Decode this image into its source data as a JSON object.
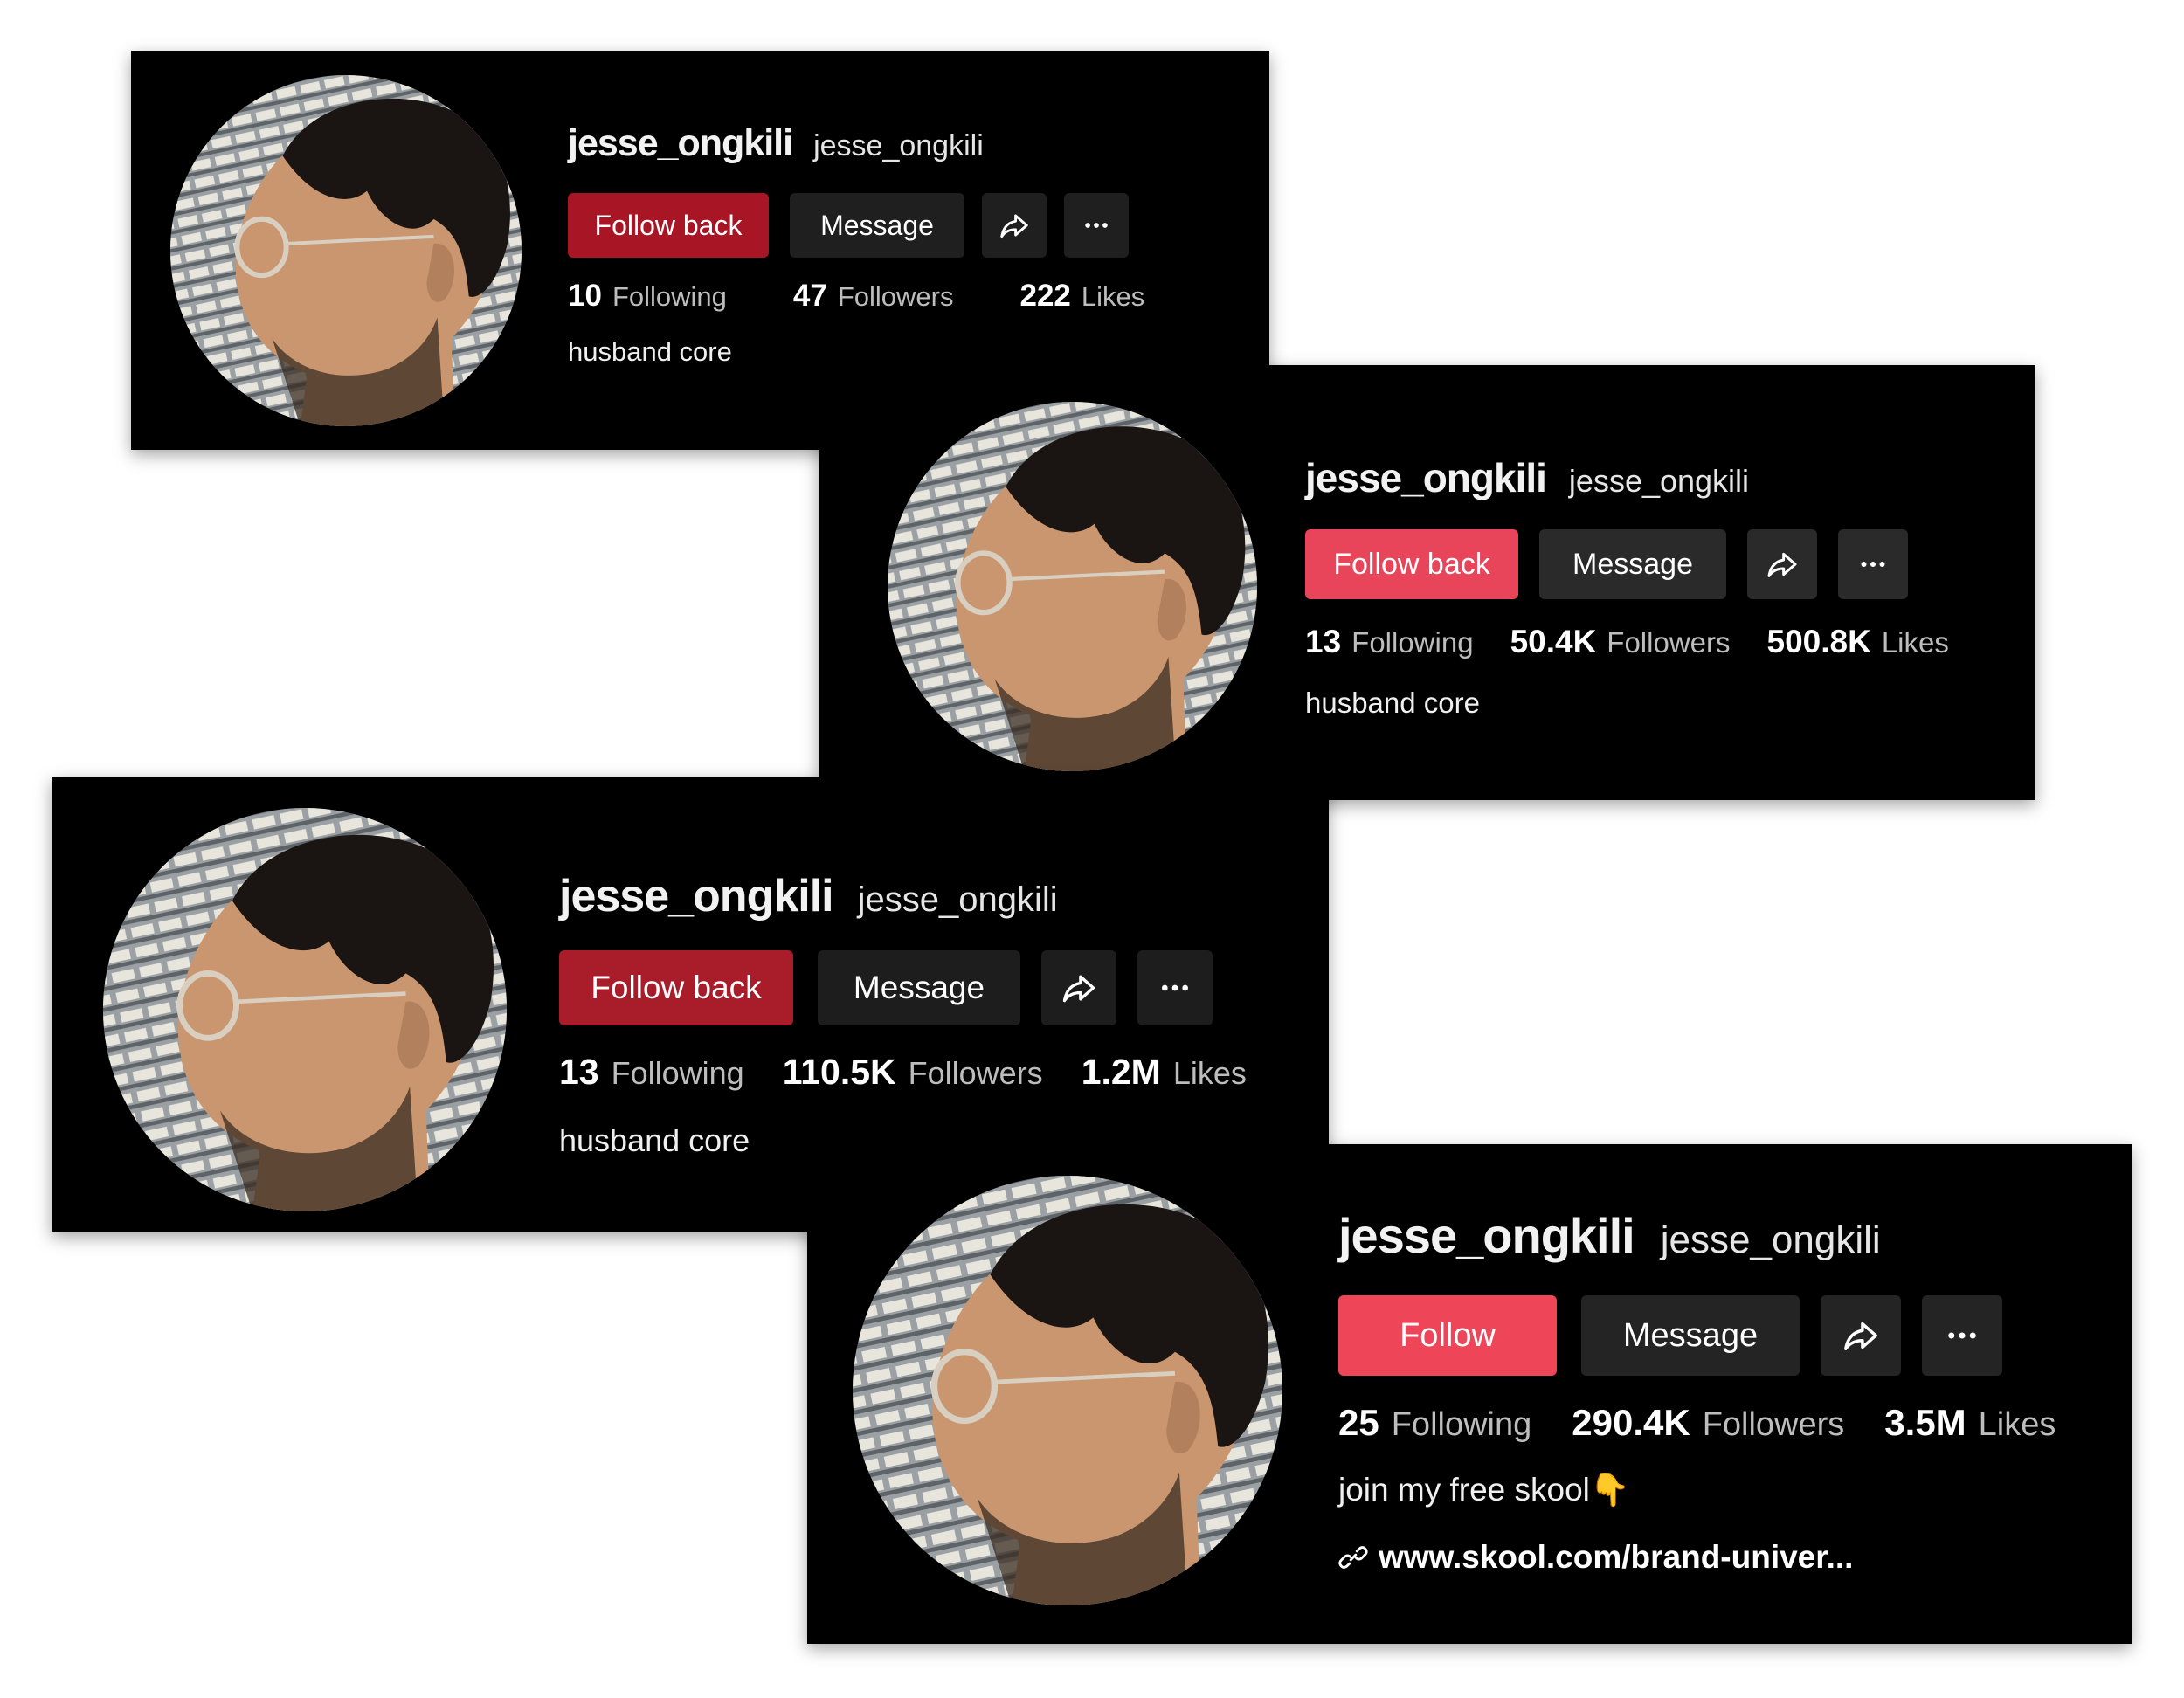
{
  "colors": {
    "card_background": "#000000",
    "page_background": "#ffffff",
    "follow_dark_red": "#a81525",
    "follow_red": "#e8445a",
    "follow_bright_red": "#ee4559",
    "secondary_button": "#1f1f1f",
    "stat_label": "#bdbdbd"
  },
  "icons": {
    "share": "share-arrow-icon",
    "more": "more-dots-icon",
    "link": "link-chain-icon",
    "pointing_down": "pointing-down-hand-emoji"
  },
  "profiles": [
    {
      "display_name": "jesse_ongkili",
      "handle": "jesse_ongkili",
      "follow_label": "Follow back",
      "message_label": "Message",
      "stats": [
        {
          "value": "10",
          "label": "Following"
        },
        {
          "value": "47",
          "label": "Followers"
        },
        {
          "value": "222",
          "label": "Likes"
        }
      ],
      "bio": "husband core"
    },
    {
      "display_name": "jesse_ongkili",
      "handle": "jesse_ongkili",
      "follow_label": "Follow back",
      "message_label": "Message",
      "stats": [
        {
          "value": "13",
          "label": "Following"
        },
        {
          "value": "50.4K",
          "label": "Followers"
        },
        {
          "value": "500.8K",
          "label": "Likes"
        }
      ],
      "bio": "husband core"
    },
    {
      "display_name": "jesse_ongkili",
      "handle": "jesse_ongkili",
      "follow_label": "Follow back",
      "message_label": "Message",
      "stats": [
        {
          "value": "13",
          "label": "Following"
        },
        {
          "value": "110.5K",
          "label": "Followers"
        },
        {
          "value": "1.2M",
          "label": "Likes"
        }
      ],
      "bio": "husband core"
    },
    {
      "display_name": "jesse_ongkili",
      "handle": "jesse_ongkili",
      "follow_label": "Follow",
      "message_label": "Message",
      "stats": [
        {
          "value": "25",
          "label": "Following"
        },
        {
          "value": "290.4K",
          "label": "Followers"
        },
        {
          "value": "3.5M",
          "label": "Likes"
        }
      ],
      "bio": "join my free skool",
      "bio_emoji": "👇",
      "link": "www.skool.com/brand-univer..."
    }
  ]
}
